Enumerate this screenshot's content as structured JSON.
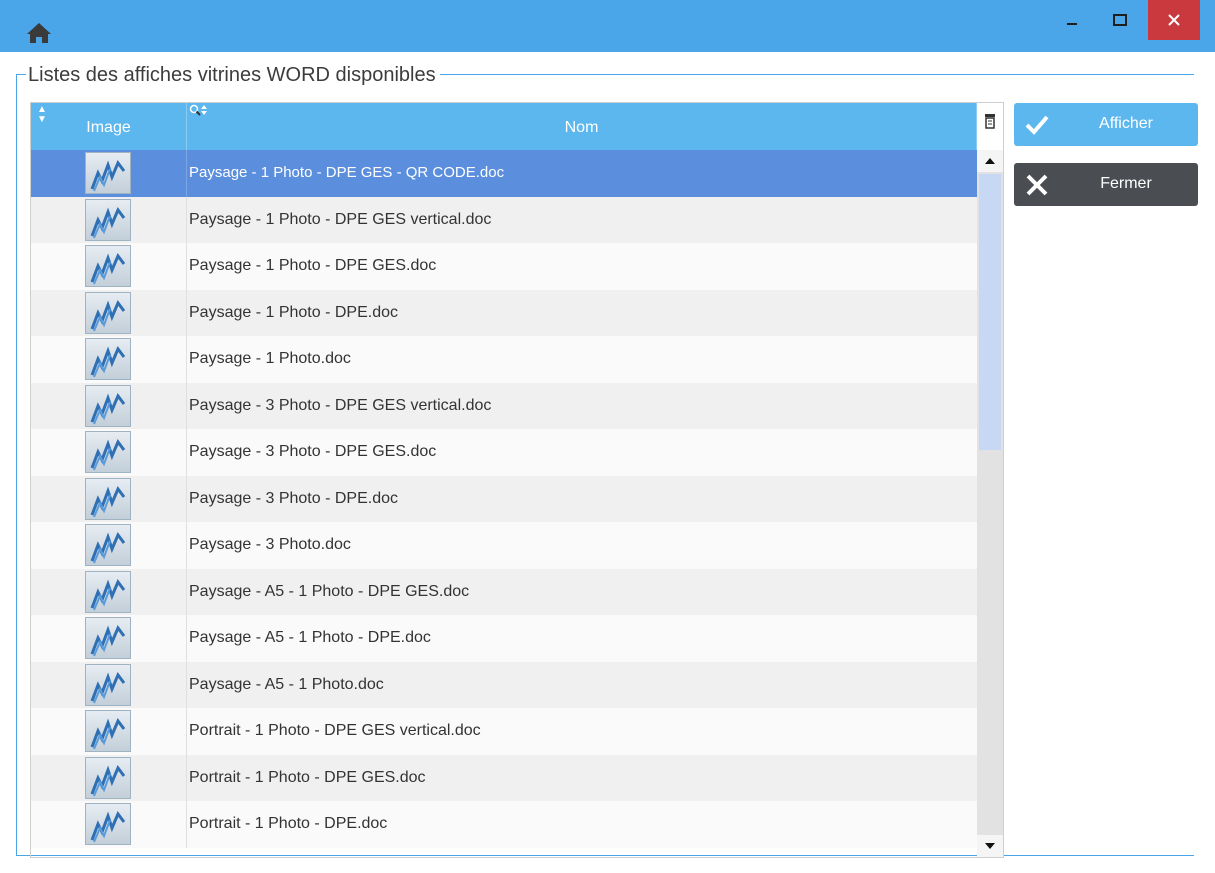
{
  "window": {
    "icons": {
      "home": "home-icon",
      "minimize": "minimize-icon",
      "maximize": "maximize-icon",
      "close": "close-icon"
    },
    "colors": {
      "titlebar": "#4aa6e8",
      "close": "#c9393e"
    }
  },
  "group": {
    "title": "Listes des affiches vitrines WORD disponibles"
  },
  "grid": {
    "columns": {
      "image": "Image",
      "nom": "Nom"
    },
    "rows": [
      {
        "name": "Paysage - 1 Photo - DPE GES - QR CODE.doc",
        "selected": true
      },
      {
        "name": "Paysage - 1 Photo - DPE GES vertical.doc"
      },
      {
        "name": "Paysage - 1 Photo - DPE GES.doc"
      },
      {
        "name": "Paysage - 1 Photo - DPE.doc"
      },
      {
        "name": "Paysage - 1 Photo.doc"
      },
      {
        "name": "Paysage - 3 Photo - DPE GES vertical.doc"
      },
      {
        "name": "Paysage - 3 Photo - DPE GES.doc"
      },
      {
        "name": "Paysage - 3 Photo - DPE.doc"
      },
      {
        "name": "Paysage - 3 Photo.doc"
      },
      {
        "name": "Paysage - A5 - 1 Photo - DPE GES.doc"
      },
      {
        "name": "Paysage - A5 - 1 Photo - DPE.doc"
      },
      {
        "name": "Paysage - A5 - 1 Photo.doc"
      },
      {
        "name": "Portrait - 1 Photo - DPE GES vertical.doc"
      },
      {
        "name": "Portrait - 1 Photo - DPE GES.doc"
      },
      {
        "name": "Portrait - 1 Photo - DPE.doc"
      }
    ],
    "colors": {
      "header": "#5db7ef",
      "selected": "#5b8fde"
    }
  },
  "buttons": {
    "afficher": {
      "label": "Afficher",
      "icon": "check-icon",
      "color": "#5db7ef"
    },
    "fermer": {
      "label": "Fermer",
      "icon": "close-x-icon",
      "color": "#4a4d52"
    }
  }
}
